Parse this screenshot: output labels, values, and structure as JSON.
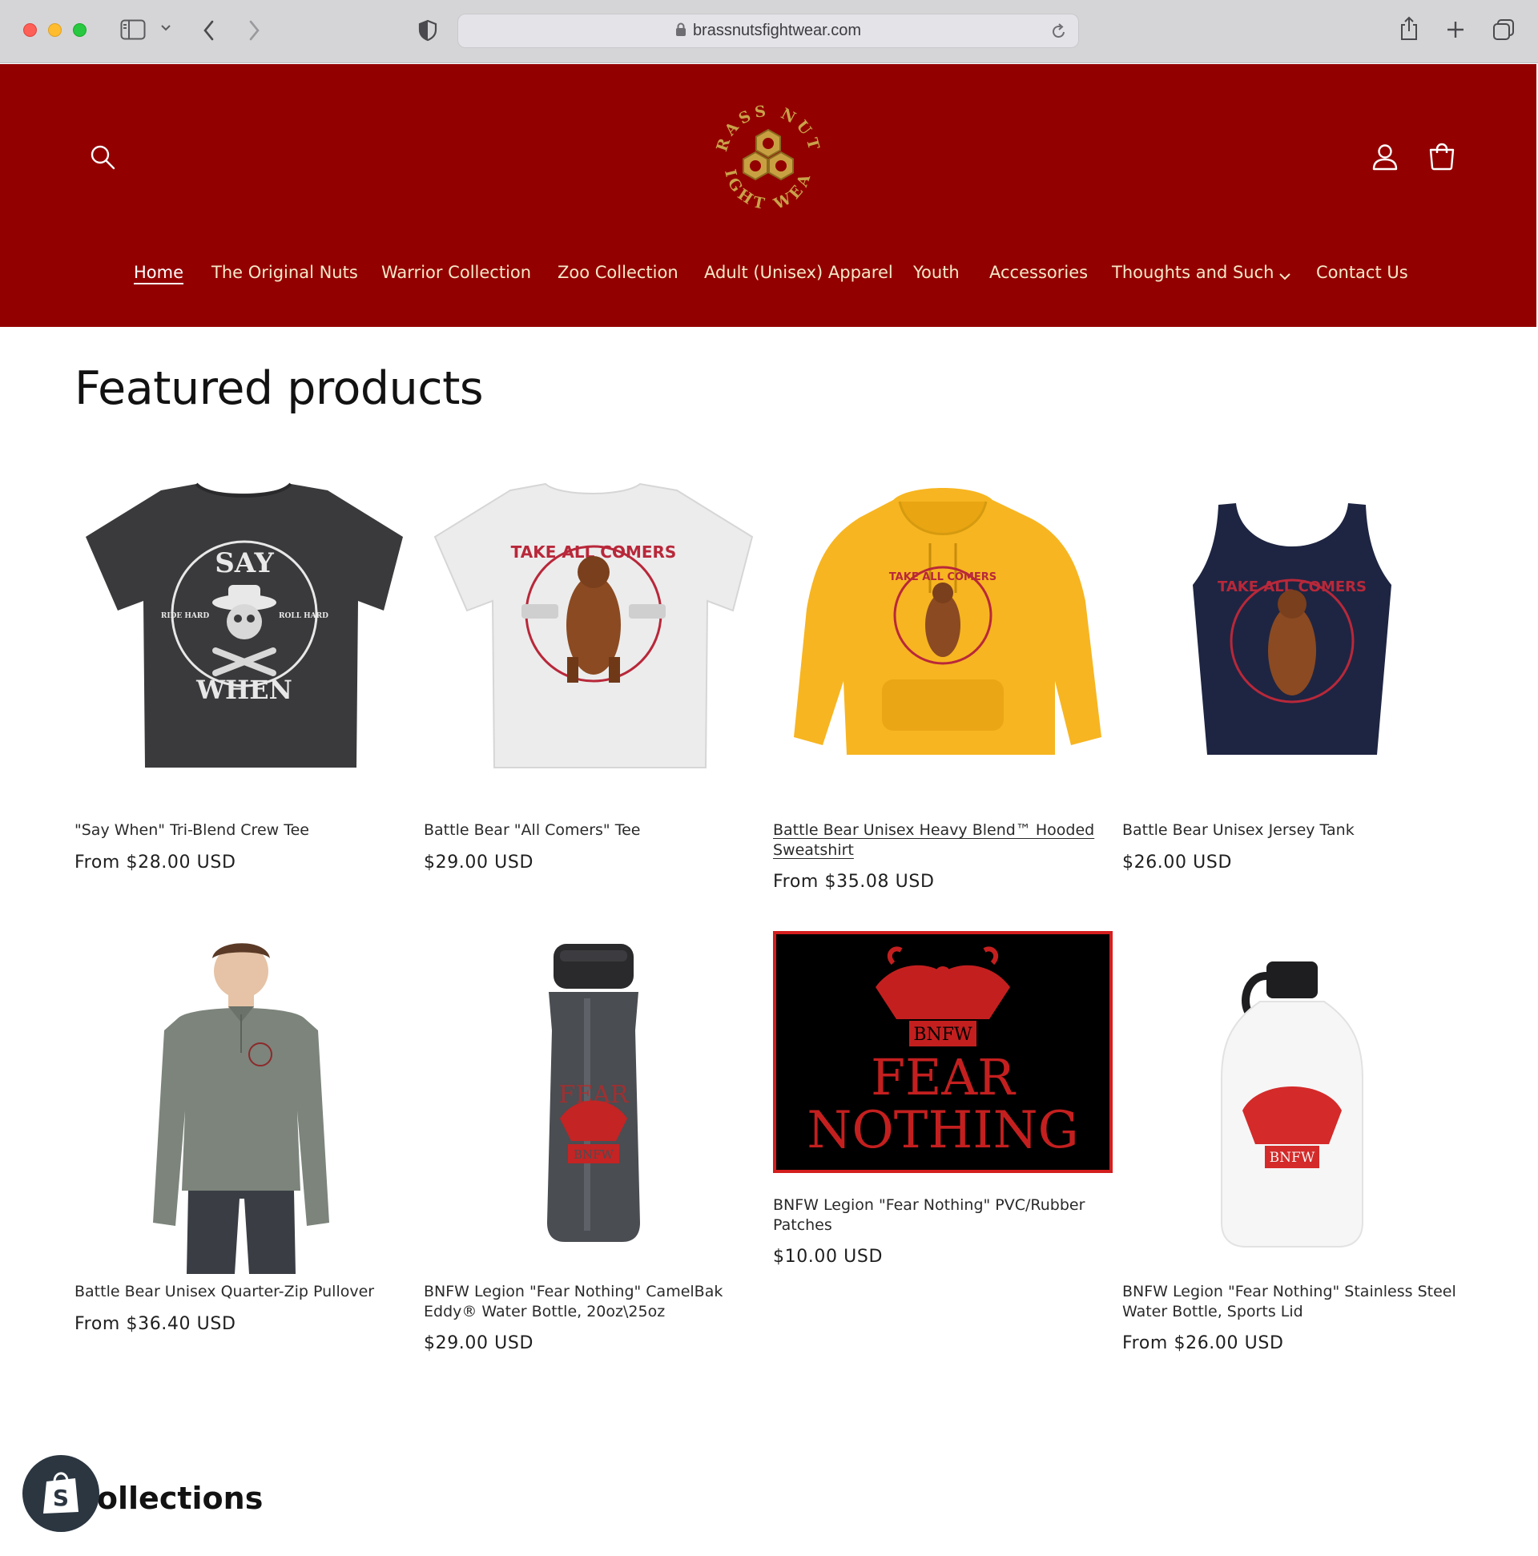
{
  "browser": {
    "url": "brassnutsfightwear.com"
  },
  "header": {
    "logo_text_top": "BRASS NUTS",
    "logo_text_bottom": "FIGHT WEAR",
    "nav": [
      {
        "label": "Home",
        "active": true
      },
      {
        "label": "The Original Nuts"
      },
      {
        "label": "Warrior Collection"
      },
      {
        "label": "Zoo Collection"
      },
      {
        "label": "Adult (Unisex) Apparel"
      },
      {
        "label": "Youth"
      },
      {
        "label": "Accessories"
      },
      {
        "label": "Thoughts and Such",
        "has_dropdown": true
      },
      {
        "label": "Contact Us"
      }
    ]
  },
  "featured": {
    "title": "Featured products",
    "products": [
      {
        "title": "\"Say When\" Tri-Blend Crew Tee",
        "price": "From $28.00 USD",
        "graphic_top": "SAY",
        "graphic_bottom": "WHEN",
        "graphic_left": "RIDE HARD",
        "graphic_right": "ROLL HARD"
      },
      {
        "title": "Battle Bear \"All Comers\" Tee",
        "price": "$29.00 USD",
        "graphic_text": "TAKE ALL COMERS"
      },
      {
        "title": "Battle Bear Unisex Heavy Blend™ Hooded Sweatshirt",
        "price": "From $35.08 USD",
        "graphic_text": "TAKE ALL COMERS"
      },
      {
        "title": "Battle Bear Unisex Jersey Tank",
        "price": "$26.00 USD",
        "graphic_text": "TAKE ALL COMERS"
      },
      {
        "title": "Battle Bear Unisex Quarter-Zip Pullover",
        "price": "From $36.40 USD"
      },
      {
        "title": "BNFW Legion \"Fear Nothing\" CamelBak Eddy® Water Bottle, 20oz\\25oz",
        "price": "$29.00 USD",
        "graphic_text": "BNFW"
      },
      {
        "title": "BNFW Legion \"Fear Nothing\" PVC/Rubber Patches",
        "price": "$10.00 USD",
        "graphic_badge": "BNFW",
        "graphic_line1": "FEAR",
        "graphic_line2": "NOTHING"
      },
      {
        "title": "BNFW Legion \"Fear Nothing\" Stainless Steel Water Bottle, Sports Lid",
        "price": "From $26.00 USD",
        "graphic_text": "BNFW"
      }
    ]
  },
  "collections": {
    "title": "Collections"
  },
  "colors": {
    "header_bg": "#930000",
    "nav_text": "#f5e9c8",
    "gold": "#c9a24a"
  }
}
